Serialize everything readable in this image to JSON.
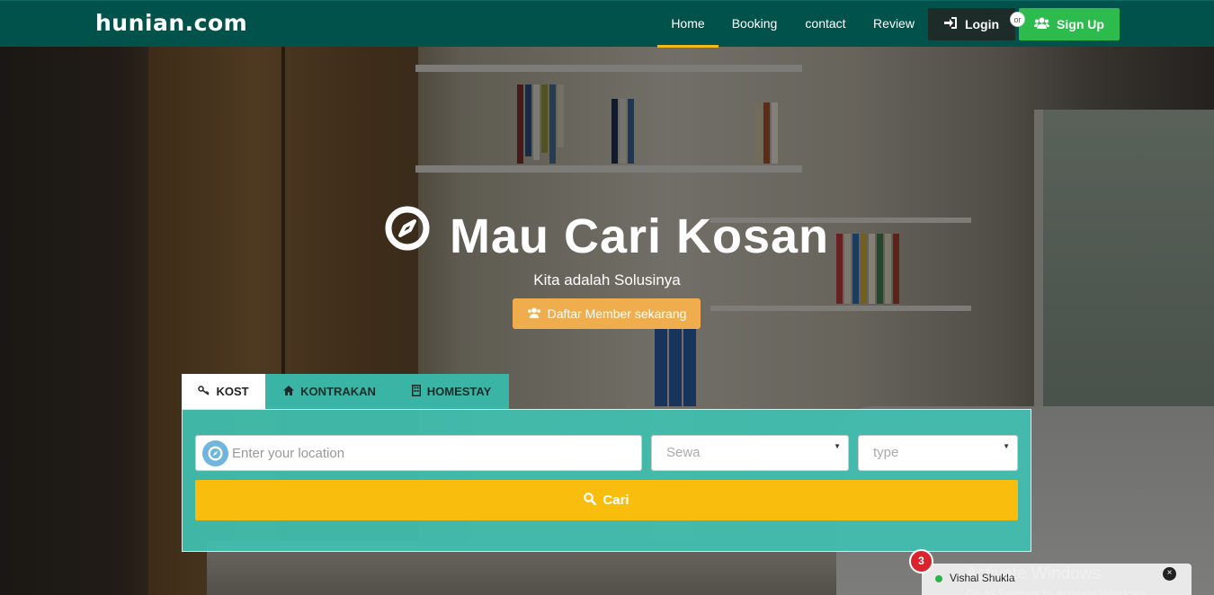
{
  "navbar": {
    "brand": "hunian.com",
    "links": [
      {
        "label": "Home",
        "active": true
      },
      {
        "label": "Booking",
        "active": false
      },
      {
        "label": "contact",
        "active": false
      },
      {
        "label": "Review",
        "active": false
      }
    ],
    "login_label": "Login",
    "login_icon": "sign-in-icon",
    "or_label": "or",
    "signup_label": "Sign Up",
    "signup_icon": "users-icon"
  },
  "hero": {
    "title": "Mau Cari Kosan",
    "title_icon": "compass-icon",
    "subtitle": "Kita adalah Solusinya",
    "member_button": "Daftar Member sekarang",
    "member_icon": "users-icon"
  },
  "search": {
    "tabs": [
      {
        "label": "KOST",
        "icon": "key-icon",
        "active": true
      },
      {
        "label": "KONTRAKAN",
        "icon": "home-icon",
        "active": false
      },
      {
        "label": "HOMESTAY",
        "icon": "building-icon",
        "active": false
      }
    ],
    "location_placeholder": "Enter your location",
    "sewa_label": "Sewa",
    "type_label": "type",
    "submit_label": "Cari",
    "submit_icon": "search-icon"
  },
  "chat": {
    "badge_count": "3",
    "name": "Vishal Shukla",
    "close_label": "×",
    "status_color": "#2db24a"
  },
  "watermark": {
    "line1": "Activate Windows",
    "line2": "Go to Settings to activate Windows."
  },
  "colors": {
    "navbar": "#00524a",
    "accent_active": "#f5b81c",
    "signup": "#2dbb4e",
    "member_button": "#f0ad4e",
    "search_panel": "#40beae",
    "search_button": "#f9bd0d"
  }
}
